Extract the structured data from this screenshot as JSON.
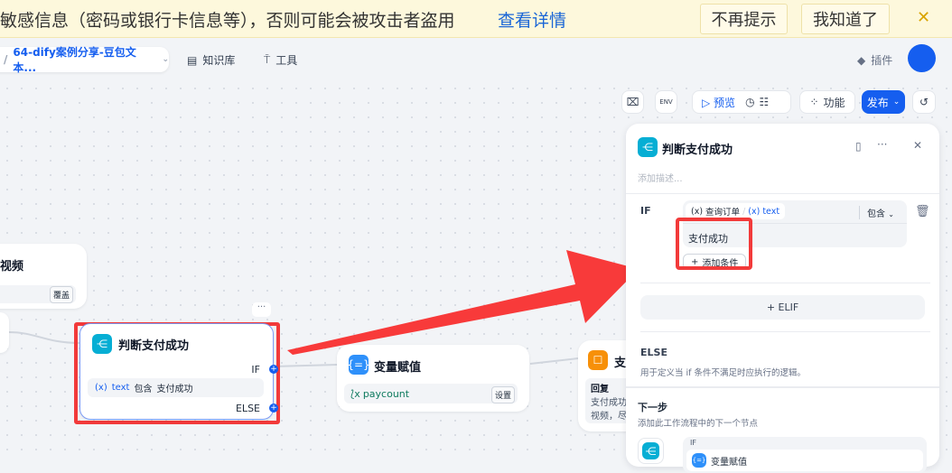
{
  "banner": {
    "message": "敏感信息（密码或银行卡信息等），否则可能会被攻击者盗用",
    "details_link": "查看详情",
    "dont_show_button": "不再提示",
    "got_it_button": "我知道了",
    "close": "✕"
  },
  "nav": {
    "app_name": "64-dify案例分享-豆包文本...",
    "knowledge": "知识库",
    "tools": "工具",
    "plugins": "插件"
  },
  "toolbar": {
    "preview": "预览",
    "features": "功能",
    "publish": "发布"
  },
  "canvas": {
    "partial_node_title": "视频",
    "partial_node_button": "覆盖",
    "if_node": {
      "title": "判断支付成功",
      "if_label": "IF",
      "else_label": "ELSE",
      "condition_var": "text",
      "condition_op": "包含",
      "condition_value": "支付成功"
    },
    "assign_node": {
      "title": "变量赋值",
      "variable": "paycount",
      "button": "设置"
    },
    "answer_node": {
      "title": "支",
      "label": "回复",
      "text1": "支付成功",
      "text2": "视频，尽"
    }
  },
  "panel": {
    "title": "判断支付成功",
    "description_placeholder": "添加描述...",
    "if_label": "IF",
    "var_node": "查询订单",
    "var_name": "text",
    "operator": "包含",
    "value": "支付成功",
    "add_condition": "添加条件",
    "elif_button": "+ ELIF",
    "else_title": "ELSE",
    "else_desc": "用于定义当 if 条件不满足时应执行的逻辑。",
    "next_title": "下一步",
    "next_desc": "添加此工作流程中的下一个节点",
    "next_branch": "IF",
    "next_node": "变量赋值"
  }
}
